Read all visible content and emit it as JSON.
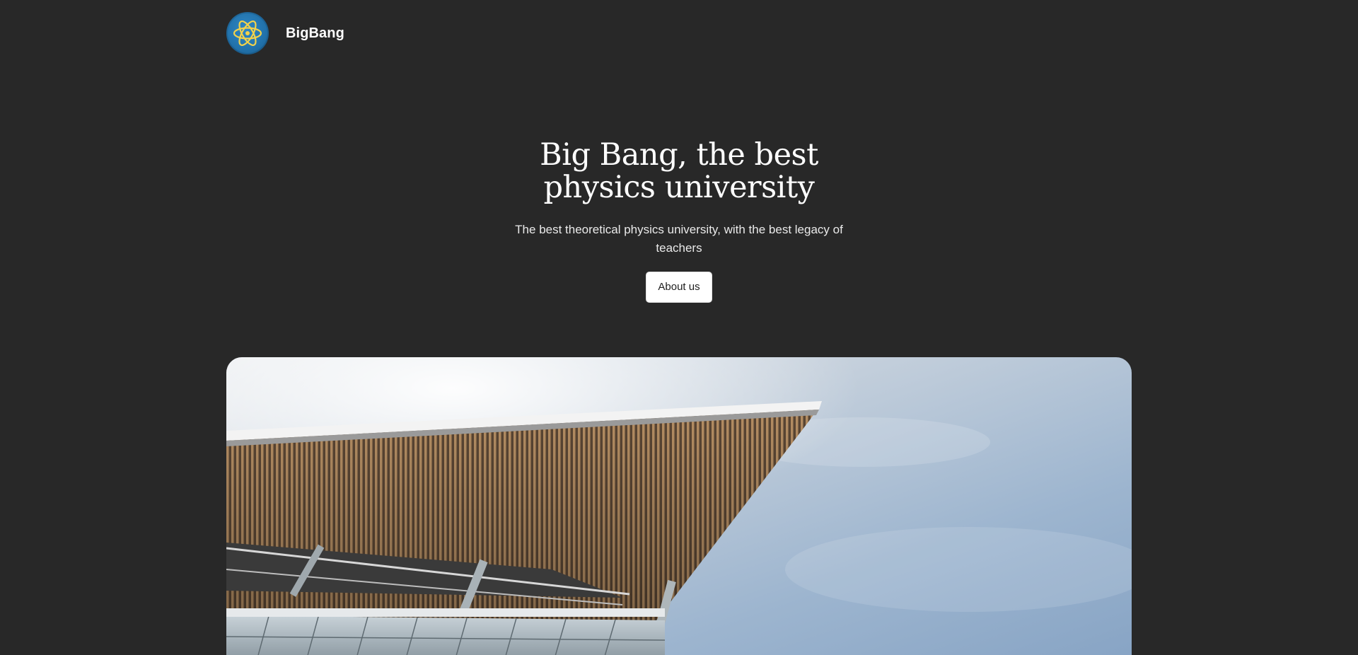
{
  "header": {
    "brand": "BigBang",
    "logo_icon": "atom-icon"
  },
  "hero": {
    "title": "Big Bang, the best physics university",
    "subtitle": "The best theoretical physics university, with the best legacy of teachers",
    "cta_label": "About us"
  },
  "image": {
    "subject": "building-photo"
  },
  "colors": {
    "background": "#282828",
    "logo_blue": "#2171aa",
    "logo_atom": "#f2d24b",
    "button_bg": "#ffffff",
    "button_text": "#1e1e1e"
  }
}
